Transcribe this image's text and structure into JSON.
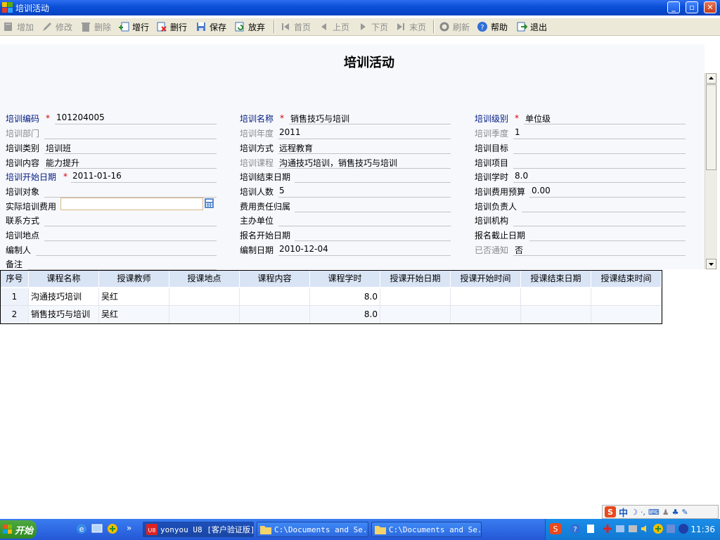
{
  "window": {
    "title": "培训活动"
  },
  "toolbar": {
    "add": "增加",
    "edit": "修改",
    "delete": "删除",
    "add_row": "增行",
    "delete_row": "删行",
    "save": "保存",
    "discard": "放弃",
    "first": "首页",
    "prev": "上页",
    "next": "下页",
    "last": "末页",
    "refresh": "刷新",
    "help": "帮助",
    "exit": "退出"
  },
  "page": {
    "title": "培训活动"
  },
  "form": {
    "code_label": "培训编码",
    "code_value": "101204005",
    "name_label": "培训名称",
    "name_value": "销售技巧与培训",
    "level_label": "培训级别",
    "level_value": "单位级",
    "dept_label": "培训部门",
    "dept_value": "",
    "year_label": "培训年度",
    "year_value": "2011",
    "quarter_label": "培训季度",
    "quarter_value": "1",
    "type_label": "培训类别",
    "type_value": "培训班",
    "method_label": "培训方式",
    "method_value": "远程教育",
    "goal_label": "培训目标",
    "goal_value": "",
    "content_label": "培训内容",
    "content_value": "能力提升",
    "course_label": "培训课程",
    "course_value": "沟通技巧培训，销售技巧与培训",
    "project_label": "培训项目",
    "project_value": "",
    "start_label": "培训开始日期",
    "start_value": "2011-01-16",
    "end_label": "培训结束日期",
    "end_value": "",
    "hours_label": "培训学时",
    "hours_value": "8.0",
    "target_label": "培训对象",
    "target_value": "",
    "count_label": "培训人数",
    "count_value": "5",
    "budget_label": "培训费用预算",
    "budget_value": "0.00",
    "actual_label": "实际培训费用",
    "actual_value": "",
    "cost_owner_label": "费用责任归属",
    "cost_owner_value": "",
    "manager_label": "培训负责人",
    "manager_value": "",
    "contact_label": "联系方式",
    "contact_value": "",
    "host_label": "主办单位",
    "host_value": "",
    "org_label": "培训机构",
    "org_value": "",
    "location_label": "培训地点",
    "location_value": "",
    "reg_start_label": "报名开始日期",
    "reg_start_value": "",
    "reg_end_label": "报名截止日期",
    "reg_end_value": "",
    "author_label": "编制人",
    "author_value": "",
    "date_label": "编制日期",
    "date_value": "2010-12-04",
    "notified_label": "已否通知",
    "notified_value": "否",
    "remark_label": "备注",
    "remark_value": "",
    "required_mark": "*"
  },
  "grid": {
    "headers": [
      "序号",
      "课程名称",
      "授课教师",
      "授课地点",
      "课程内容",
      "课程学时",
      "授课开始日期",
      "授课开始时间",
      "授课结束日期",
      "授课结束时间"
    ],
    "rows": [
      [
        "1",
        "沟通技巧培训",
        "吴红",
        "",
        "",
        "8.0",
        "",
        "",
        "",
        ""
      ],
      [
        "2",
        "销售技巧与培训",
        "吴红",
        "",
        "",
        "8.0",
        "",
        "",
        "",
        ""
      ]
    ]
  },
  "ime": {
    "mode": "中"
  },
  "taskbar": {
    "start": "开始",
    "more": "»",
    "tasks": [
      "yonyou U8 [客户验证版]",
      "C:\\Documents and Se...",
      "C:\\Documents and Se..."
    ],
    "clock": "11:36"
  },
  "colors": {
    "title_bar": "#0a4fd6",
    "header_bg": "#d9e4f5",
    "required": "#d00000",
    "taskbar": "#2458d6"
  }
}
